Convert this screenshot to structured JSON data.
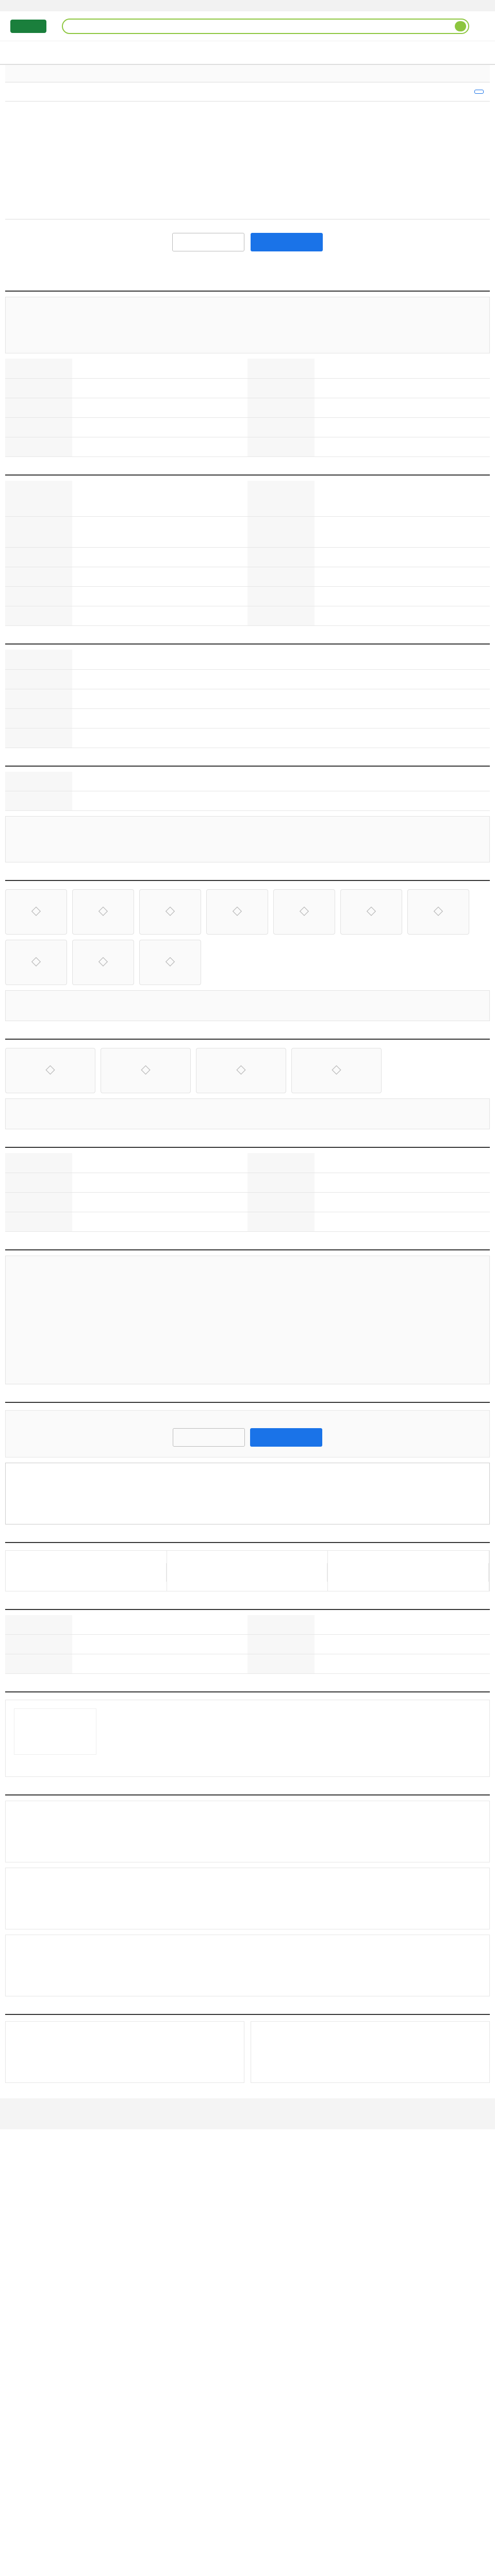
{
  "header": {
    "logo": "",
    "search_placeholder": ""
  },
  "gnb": [
    "",
    "",
    "",
    "",
    "",
    ""
  ],
  "subtabs": [
    "",
    "",
    "",
    "",
    "",
    "",
    ""
  ],
  "job": {
    "title": "",
    "top_button": ""
  },
  "summary": {
    "left_items": [],
    "right_items": []
  },
  "actions": {
    "save": "",
    "apply": "",
    "note": ""
  },
  "sections": {
    "recruit": "",
    "conditions": "",
    "prefer": "",
    "welfare": "",
    "disability": "",
    "process": "",
    "contact": "",
    "stats": "",
    "guide": "",
    "company": "",
    "related": "",
    "others": ""
  },
  "recruit_box": "",
  "stats": []
}
